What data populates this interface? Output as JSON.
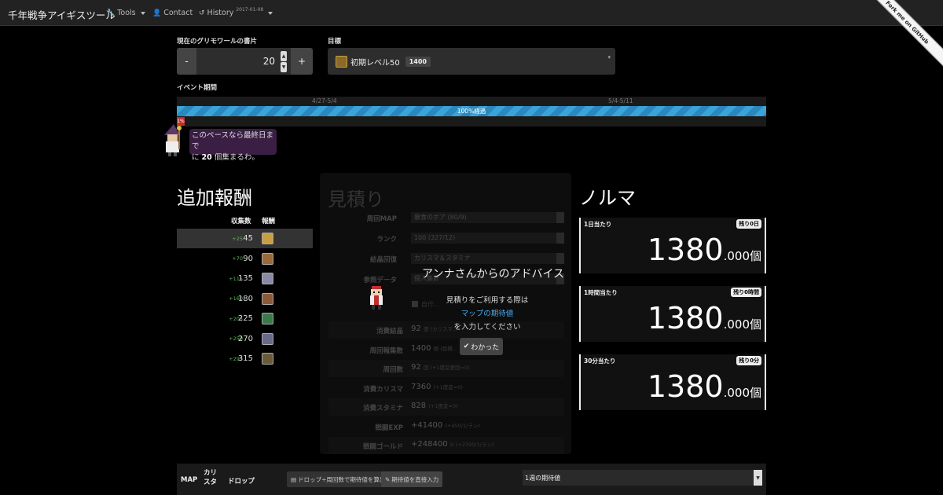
{
  "navbar": {
    "brand": "千年戦争アイギスツール",
    "tools_label": "Tools",
    "contact_label": "Contact",
    "history_label": "History",
    "history_version": "2017-01-08",
    "ribbon_label": "Fork me on GitHub"
  },
  "grimoire": {
    "label": "現在のグリモワールの書片",
    "minus": "-",
    "plus": "+",
    "value": "20"
  },
  "goal": {
    "label": "目標",
    "text": "初期レベル50",
    "badge": "1400"
  },
  "event_period": {
    "label": "イベント期間",
    "start_label": "4/27-5/4",
    "end_label": "5/4-5/11",
    "progress_text": "100%経過",
    "progress": 1.0,
    "marker": "1%"
  },
  "advice": {
    "line1": "このペースなら最終日まで",
    "line2_prefix": "に",
    "line2_count": "20",
    "line2_suffix": "個集まるわ。"
  },
  "rewards": {
    "title": "追加報酬",
    "col_count": "収集数",
    "col_reward": "報酬",
    "rows": [
      {
        "plus": "+25",
        "value": "45",
        "color": "#c9a040"
      },
      {
        "plus": "+70",
        "value": "90",
        "color": "#9a6a3a"
      },
      {
        "plus": "+115",
        "value": "135",
        "color": "#8a8aa8"
      },
      {
        "plus": "+160",
        "value": "180",
        "color": "#8a5a3a"
      },
      {
        "plus": "+205",
        "value": "225",
        "color": "#3a7a4a"
      },
      {
        "plus": "+250",
        "value": "270",
        "color": "#6a6a8a"
      },
      {
        "plus": "+295",
        "value": "315",
        "color": "#6a5a3a"
      }
    ]
  },
  "estimate": {
    "title": "見積り",
    "fields": [
      {
        "label": "周回MAP",
        "value": "暴食のボア (80/9)"
      },
      {
        "label": "ランク",
        "value": "100 (327/12)"
      },
      {
        "label": "結晶回復",
        "value": "カリスマ＆スタミナ"
      },
      {
        "label": "参照データ",
        "value": "個人集計"
      }
    ],
    "rows": [
      {
        "label": "消費結晶",
        "value": "92",
        "sub": "個 (カリスマ..."
      },
      {
        "label": "周回報集数",
        "value": "1400",
        "sub": "個 (目標..."
      },
      {
        "label": "周回数",
        "value": "92",
        "sub": "回 (+1度変更回=0)"
      },
      {
        "label": "消費カリスマ",
        "value": "7360",
        "sub": "(+1度変=0)"
      },
      {
        "label": "消費スタミナ",
        "value": "828",
        "sub": "(+1度変=0)"
      },
      {
        "label": "戦闘EXP",
        "value": "+41400",
        "sub": "(+450/1/ラン)"
      },
      {
        "label": "戦闘ゴールド",
        "value": "+248400",
        "sub": "G (+2700/1/ラン)"
      }
    ]
  },
  "popover": {
    "title": "アンナさんからのアドバイス",
    "line1": "見積りをご利用する際は",
    "link": "マップの期待値",
    "line3": "を入力してください",
    "button": "わかった"
  },
  "quota": {
    "title": "ノルマ",
    "boxes": [
      {
        "label": "1日当たり",
        "badge": "残り0日",
        "value": "1380",
        "decimal": ".000個"
      },
      {
        "label": "1時間当たり",
        "badge": "残り0時間",
        "value": "1380",
        "decimal": ".000個"
      },
      {
        "label": "30分当たり",
        "badge": "残り0分",
        "value": "1380",
        "decimal": ".000個"
      }
    ]
  },
  "footer": {
    "col_map": "MAP",
    "col_charisma": "カリスタ",
    "col_drop": "ドロップ",
    "btn_calc": "ドロップ÷周回数で期待値を算出",
    "btn_direct": "期待値を直接入力",
    "select_value": "1週の期待値"
  }
}
